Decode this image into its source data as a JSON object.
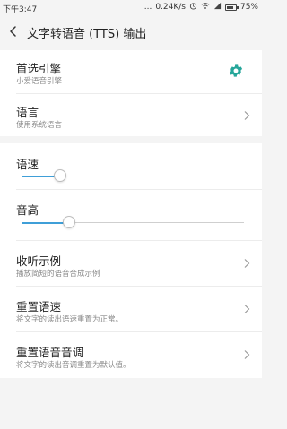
{
  "status_bar": {
    "time": "下午3:47",
    "dots": "...",
    "network_speed": "0.24K/s",
    "battery": "75%",
    "battery_level": 0.75
  },
  "header": {
    "title": "文字转语音 (TTS) 输出"
  },
  "engine_section": {
    "preferred_engine": {
      "title": "首选引擎",
      "subtitle": "小爱语音引擎"
    },
    "language": {
      "title": "语言",
      "subtitle": "使用系统语言"
    }
  },
  "settings_section": {
    "speech_rate": {
      "title": "语速",
      "level": 0.17
    },
    "pitch": {
      "title": "音高",
      "level": 0.21
    },
    "listen_example": {
      "title": "收听示例",
      "subtitle": "播放简短的语音合成示例"
    },
    "reset_rate": {
      "title": "重置语速",
      "subtitle": "将文字的读出语速重置为正常。"
    },
    "reset_pitch": {
      "title": "重置语音音调",
      "subtitle": "将文字的读出音调重置为默认值。"
    }
  },
  "colors": {
    "accent": "#3f9fd8",
    "gear": "#26a69a"
  }
}
